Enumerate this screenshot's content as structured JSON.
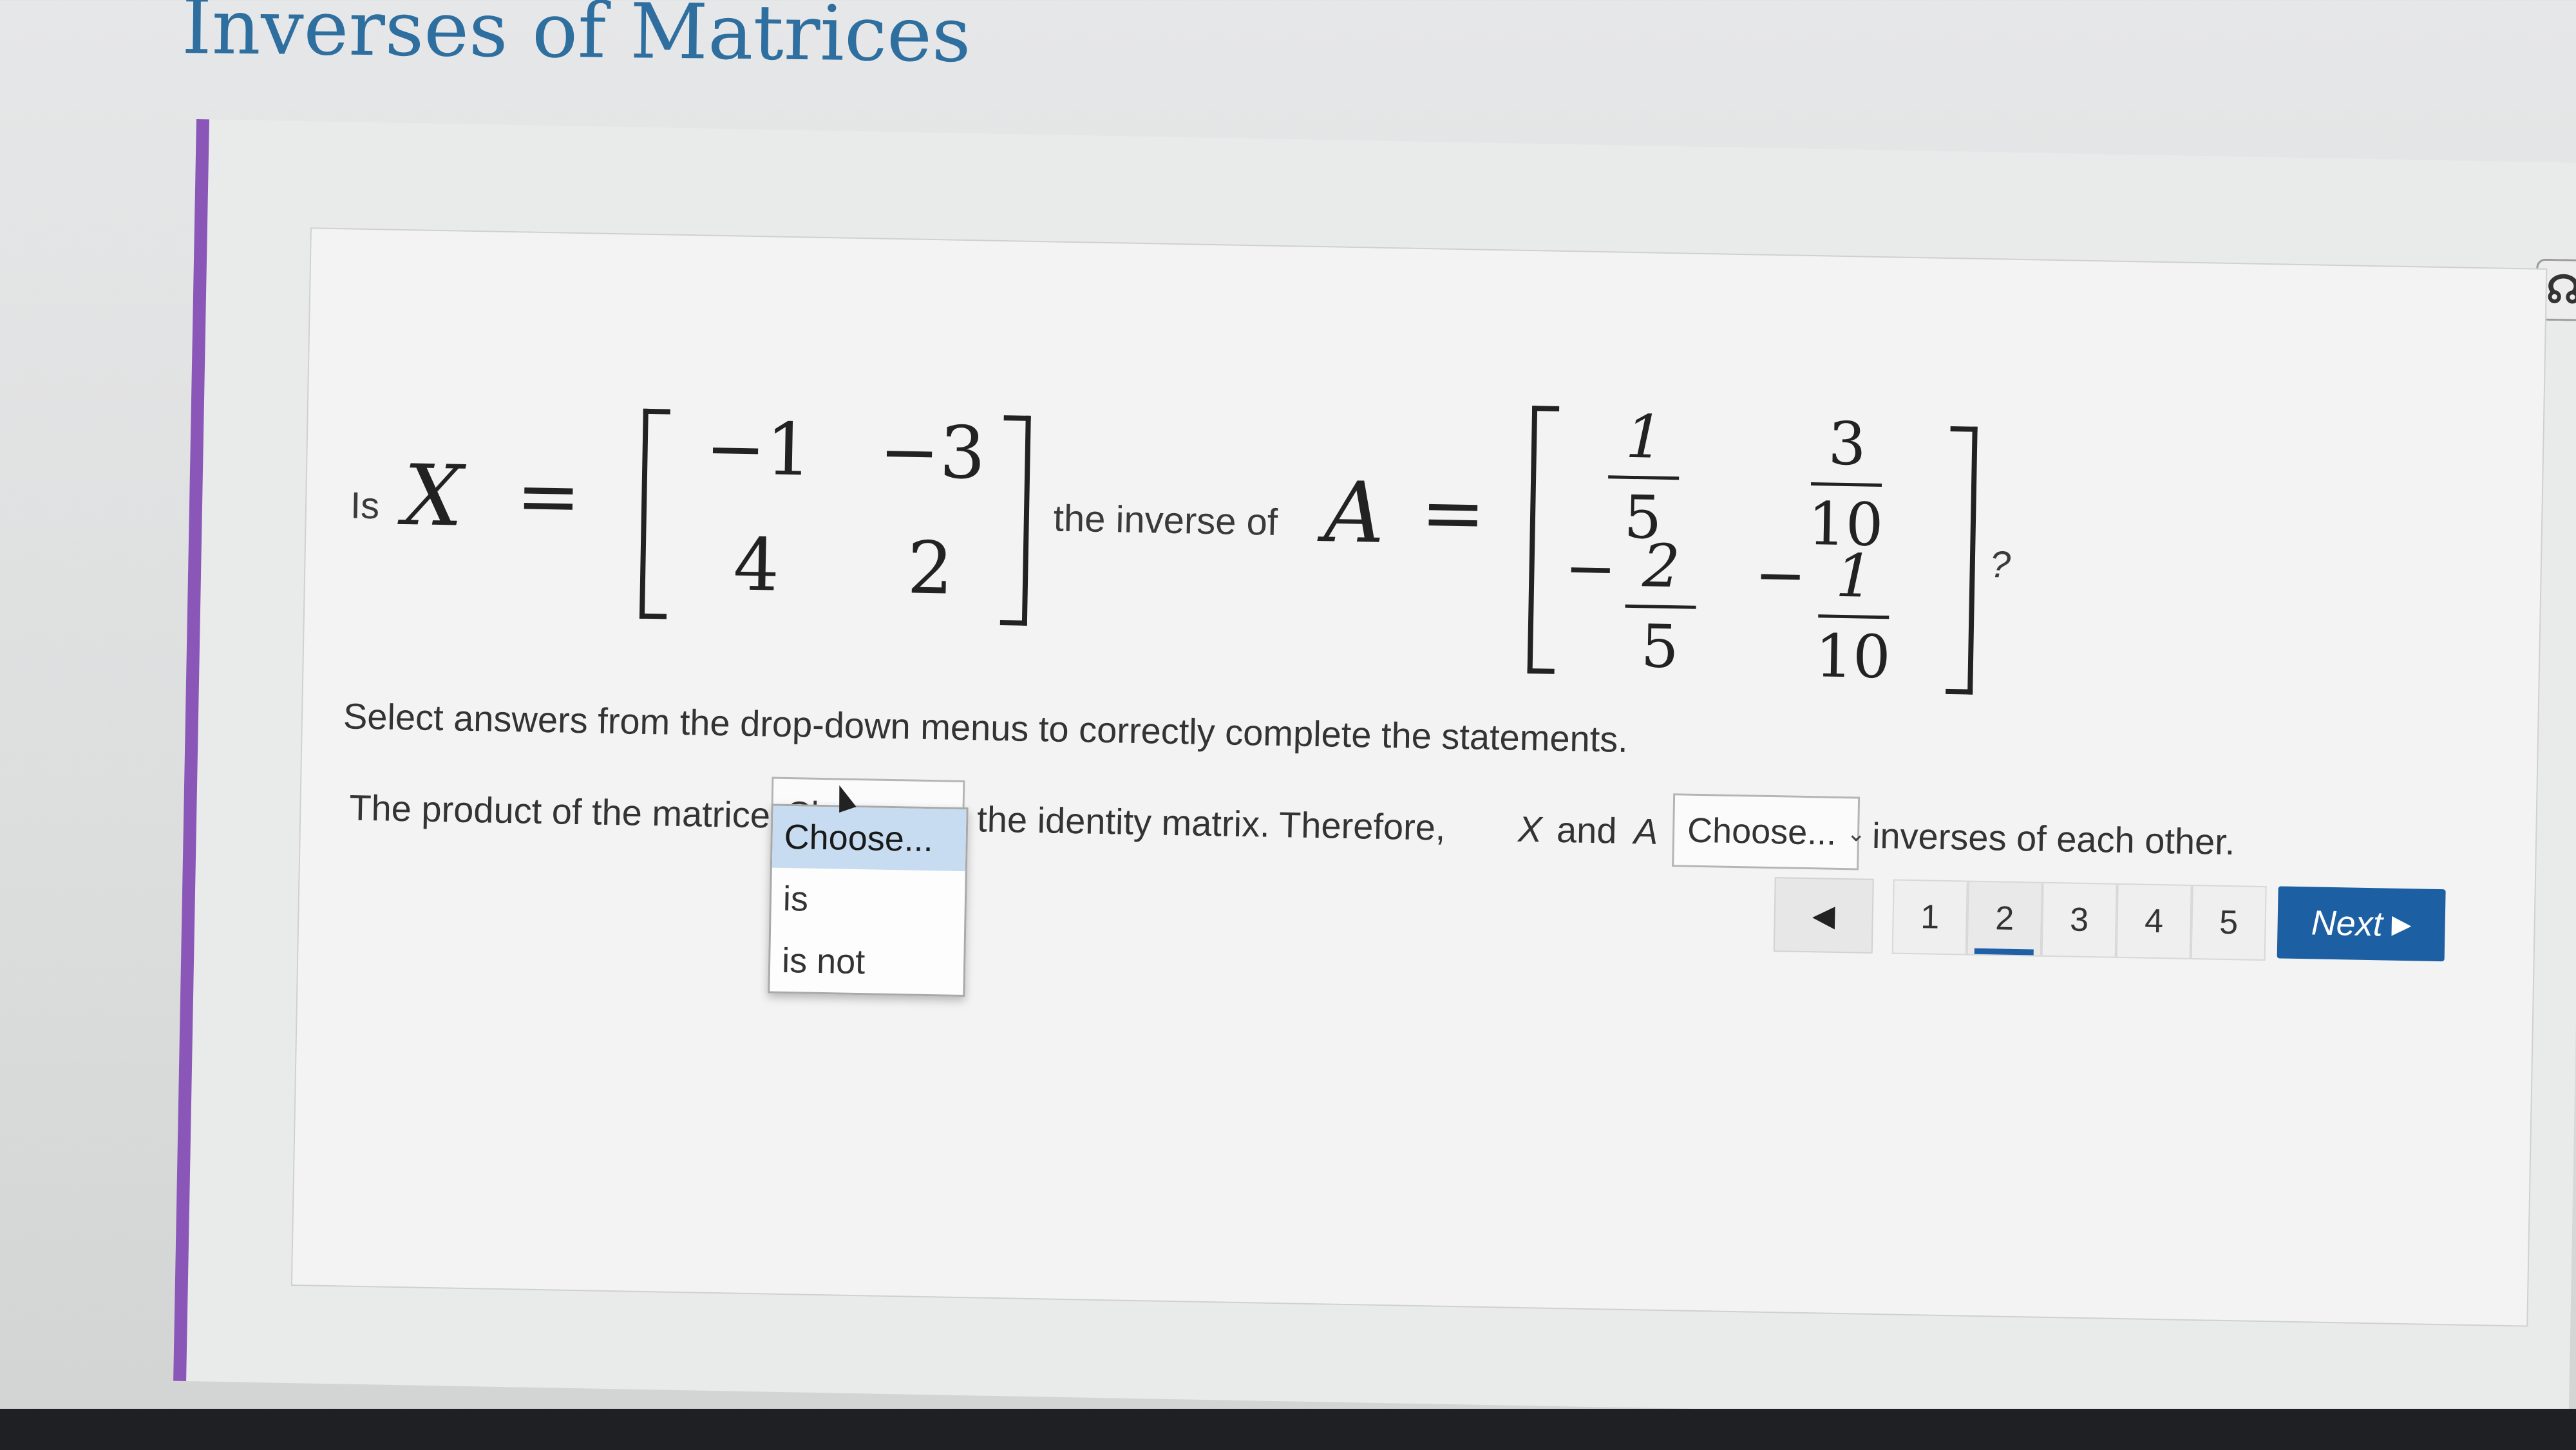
{
  "header": {
    "title": "Inverses of Matrices"
  },
  "question": {
    "lead": "Is",
    "matrix_x": {
      "name": "X",
      "rows": [
        [
          "−1",
          "−3"
        ],
        [
          "4",
          "2"
        ]
      ]
    },
    "mid_text": "the inverse of",
    "matrix_a": {
      "name": "A",
      "rows": [
        [
          {
            "sign": "",
            "num": "1",
            "den": "5"
          },
          {
            "sign": "",
            "num": "3",
            "den": "10"
          }
        ],
        [
          {
            "sign": "−",
            "num": "2",
            "den": "5"
          },
          {
            "sign": "−",
            "num": "1",
            "den": "10"
          }
        ]
      ]
    },
    "tail": "?",
    "equals": "="
  },
  "instruction": "Select answers from the drop-down menus to correctly complete the statements.",
  "statement": {
    "part1": "The product of the matrices",
    "part2": "the identity matrix. Therefore,",
    "var_x": "X",
    "and_text": "and",
    "var_a": "A",
    "part3": "inverses of each other.",
    "dropdown1": {
      "value": "Choose...",
      "open": true,
      "options": [
        "Choose...",
        "is",
        "is not"
      ],
      "selected_index": 0
    },
    "dropdown2": {
      "value": "Choose..."
    }
  },
  "pagination": {
    "prev_symbol": "◀",
    "pages": [
      "1",
      "2",
      "3",
      "4",
      "5"
    ],
    "current": "2",
    "next_label": "Next",
    "next_symbol": "▶"
  },
  "colors": {
    "accent": "#8a57b8",
    "title": "#2f6fa0",
    "next_button": "#1d5fa3",
    "selected_option": "#c7dcf0"
  }
}
